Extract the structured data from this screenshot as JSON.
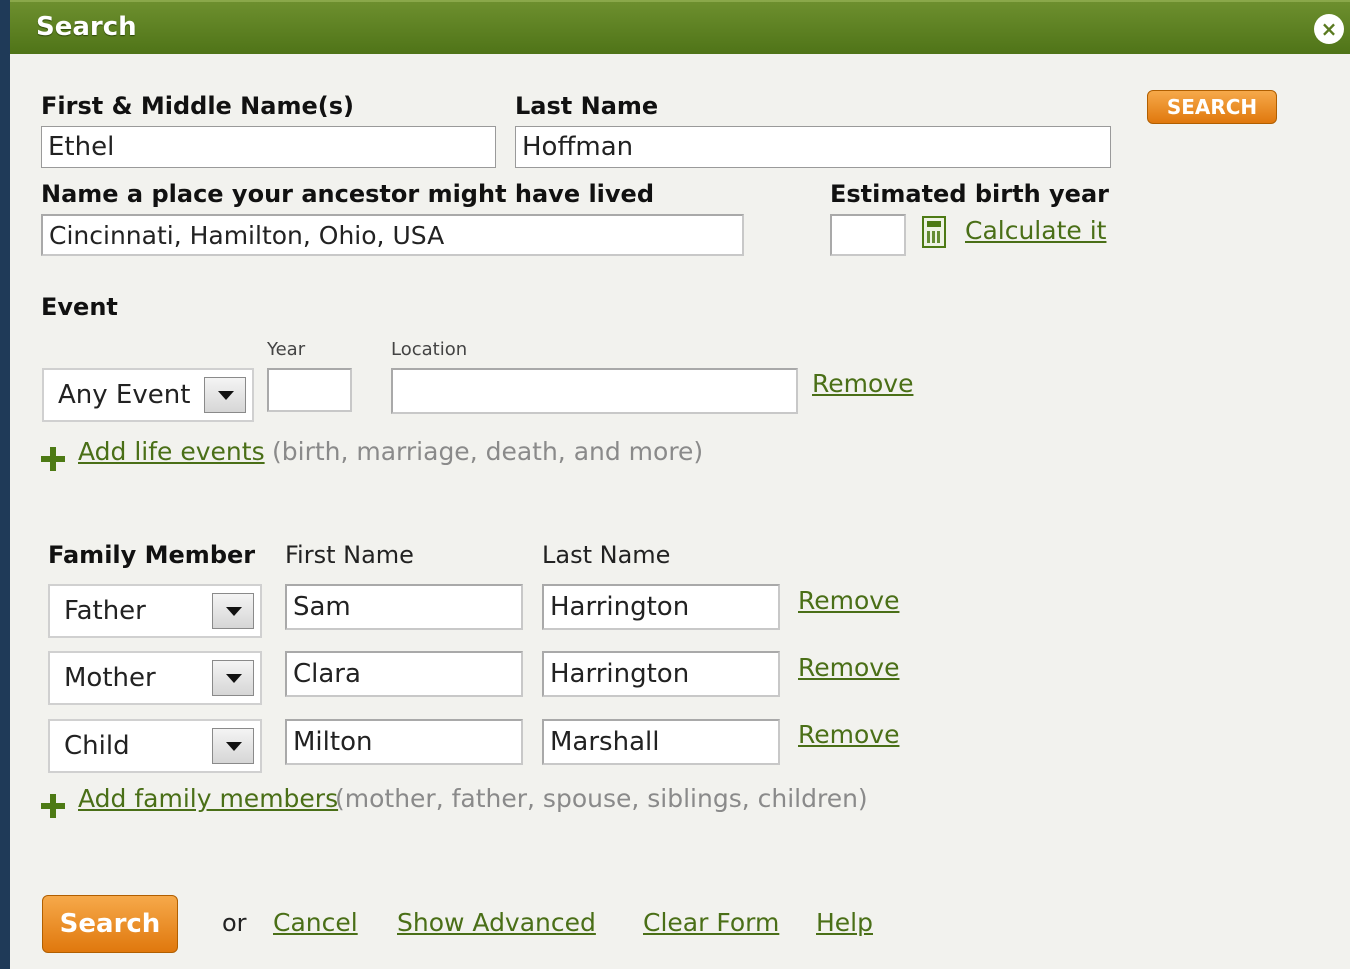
{
  "dialog": {
    "title": "Search",
    "close_label": "×"
  },
  "top_search_button": "SEARCH",
  "name": {
    "first_label": "First & Middle Name(s)",
    "first_value": "Ethel",
    "last_label": "Last Name",
    "last_value": "Hoffman"
  },
  "place": {
    "label": "Name a place your ancestor might have lived",
    "value": "Cincinnati, Hamilton, Ohio, USA"
  },
  "birth_year": {
    "label": "Estimated birth year",
    "value": "",
    "calculate_link": "Calculate it"
  },
  "event": {
    "heading": "Event",
    "year_label": "Year",
    "location_label": "Location",
    "type_value": "Any Event",
    "year_value": "",
    "location_value": "",
    "remove_link": "Remove",
    "add_link": "Add life events",
    "add_hint": "(birth, marriage, death, and more)"
  },
  "family": {
    "heading": "Family Member",
    "first_name_header": "First Name",
    "last_name_header": "Last Name",
    "members": [
      {
        "relation": "Father",
        "first": "Sam",
        "last": "Harrington",
        "remove": "Remove"
      },
      {
        "relation": "Mother",
        "first": "Clara",
        "last": "Harrington",
        "remove": "Remove"
      },
      {
        "relation": "Child",
        "first": "Milton",
        "last": "Marshall",
        "remove": "Remove"
      }
    ],
    "add_link": "Add family members",
    "add_hint": "(mother, father, spouse, siblings, children)"
  },
  "footer": {
    "search_button": "Search",
    "or_text": "or",
    "cancel": "Cancel",
    "show_advanced": "Show Advanced",
    "clear_form": "Clear Form",
    "help": "Help"
  }
}
